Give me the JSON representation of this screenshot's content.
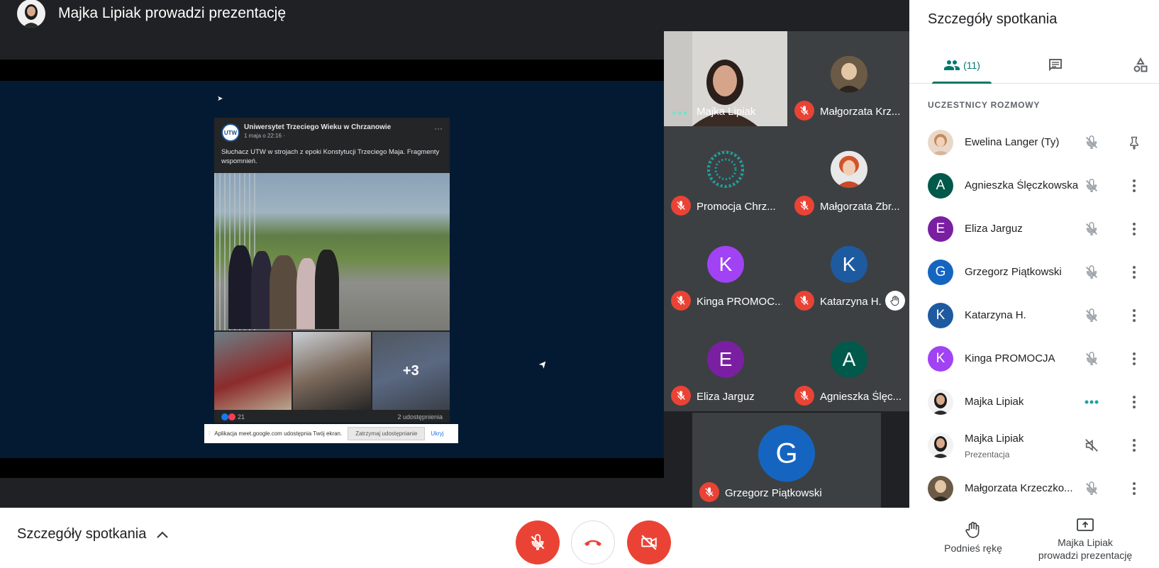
{
  "topbar": {
    "title": "Majka Lipiak prowadzi prezentację"
  },
  "post": {
    "logo_text": "UTW",
    "page_name": "Uniwersytet Trzeciego Wieku w Chrzanowie",
    "date": "1 maja o 22:16 · ",
    "menu": "···",
    "text": "Słuchacz UTW w strojach z epoki Konstytucji Trzeciego Maja. Fragmenty wspomnień.",
    "more_photos": "+3",
    "reactions": "21",
    "shares": "2 udostępnienia"
  },
  "sharebar": {
    "grip": "⁞",
    "message": "Aplikacja meet.google.com udostępnia Twój ekran.",
    "stop_label": "Zatrzymaj udostępnianie",
    "hide_label": "Ukryj"
  },
  "tiles": [
    {
      "name": "Majka Lipiak"
    },
    {
      "name": "Małgorzata Krz..."
    },
    {
      "name": "Promocja Chrz..."
    },
    {
      "name": "Małgorzata Zbr..."
    },
    {
      "name": "Kinga PROMOC...",
      "initial": "K",
      "color": "#a142f4"
    },
    {
      "name": "Katarzyna H.",
      "initial": "K",
      "color": "#1e5aa0"
    },
    {
      "name": "Eliza Jarguz",
      "initial": "E",
      "color": "#7b1fa2"
    },
    {
      "name": "Agnieszka Ślęc...",
      "initial": "A",
      "color": "#00594a"
    },
    {
      "name": "Grzegorz Piątkowski",
      "initial": "G",
      "color": "#1565c0"
    }
  ],
  "panel": {
    "title": "Szczegóły spotkania",
    "people_count": "(11)",
    "section": "UCZESTNICY ROZMOWY",
    "participants": [
      {
        "name": "Ewelina Langer (Ty)"
      },
      {
        "name": "Agnieszka Ślęczkowska",
        "initial": "A",
        "color": "#00594a"
      },
      {
        "name": "Eliza Jarguz",
        "initial": "E",
        "color": "#7b1fa2"
      },
      {
        "name": "Grzegorz Piątkowski",
        "initial": "G",
        "color": "#1565c0"
      },
      {
        "name": "Katarzyna H.",
        "initial": "K",
        "color": "#1e5aa0"
      },
      {
        "name": "Kinga PROMOCJA",
        "initial": "K",
        "color": "#a142f4"
      },
      {
        "name": "Majka Lipiak"
      },
      {
        "name": "Majka Lipiak",
        "sub": "Prezentacja"
      },
      {
        "name": "Małgorzata Krzeczko..."
      }
    ]
  },
  "bottom": {
    "details_label": "Szczegóły spotkania",
    "raise_hand_label": "Podnieś rękę",
    "presenting_line1": "Majka Lipiak",
    "presenting_line2": "prowadzi prezentację"
  },
  "colors": {
    "accent": "#00796b",
    "danger": "#ea4335"
  }
}
